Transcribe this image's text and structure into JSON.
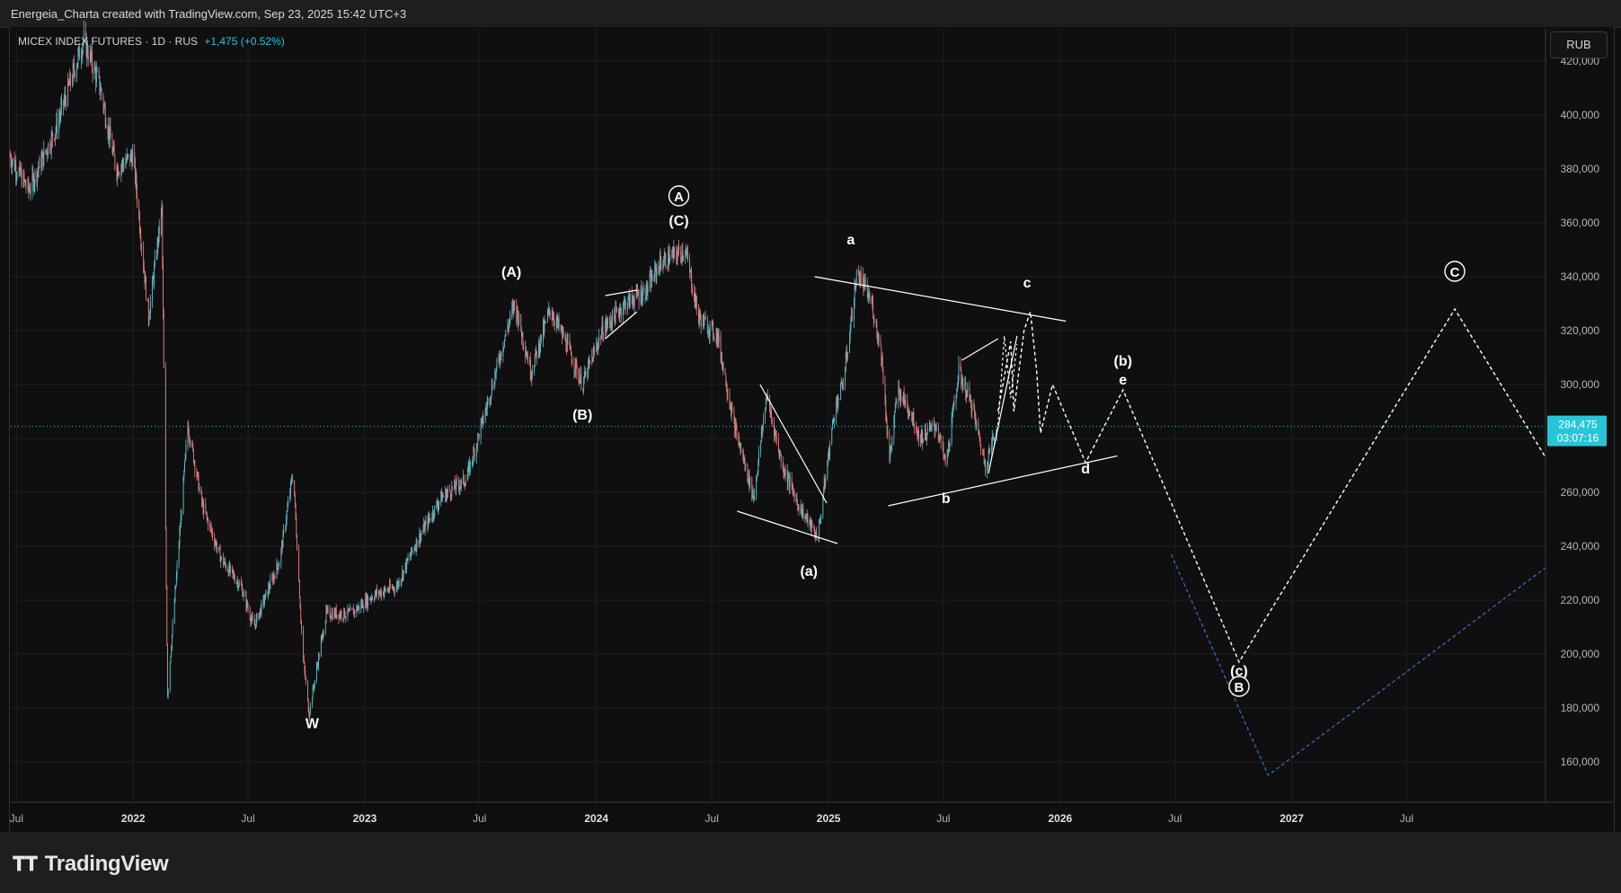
{
  "header": {
    "attribution": "Energeia_Charta created with TradingView.com, Sep 23, 2025 15:42 UTC+3"
  },
  "legend": {
    "symbol": "MICEX INDEX FUTURES · 1D · RUS",
    "change": "+1,475 (+0.52%)"
  },
  "currency_button": "RUB",
  "footer": {
    "logo_text": "TradingView",
    "logo_icon": "tradingview-logo-icon"
  },
  "price_label": {
    "value": "284,475",
    "countdown": "03:07:16"
  },
  "colors": {
    "background": "#0f0f0f",
    "up_candle": "#5fb7c4",
    "down_candle": "#e07a7a",
    "accent": "#26c6da",
    "wave_lines": "#ffffff",
    "projection_blue": "#3b6fd9"
  },
  "chart_data": {
    "type": "candlestick",
    "title": "",
    "xlabel": "",
    "ylabel": "",
    "x_ticks": [
      "Jul",
      "2022",
      "Jul",
      "2023",
      "Jul",
      "2024",
      "Jul",
      "2025",
      "Jul",
      "2026",
      "Jul",
      "2027",
      "Jul"
    ],
    "x_tick_dates": [
      "2021-07-01",
      "2022-01-01",
      "2022-07-01",
      "2023-01-01",
      "2023-07-01",
      "2024-01-01",
      "2024-07-01",
      "2025-01-01",
      "2025-07-01",
      "2026-01-01",
      "2026-07-01",
      "2027-01-01",
      "2027-07-01"
    ],
    "y_ticks": [
      160000,
      180000,
      200000,
      220000,
      240000,
      260000,
      280000,
      300000,
      320000,
      340000,
      360000,
      380000,
      400000,
      420000
    ],
    "y_tick_labels": [
      "160,000",
      "180,000",
      "200,000",
      "220,000",
      "240,000",
      "260,000",
      "280,000",
      "300,000",
      "320,000",
      "340,000",
      "360,000",
      "380,000",
      "400,000",
      "420,000"
    ],
    "ylim": [
      145000,
      432000
    ],
    "last_price": 284475,
    "price_anchors": [
      [
        "2021-06-20",
        385000
      ],
      [
        "2021-07-20",
        372000
      ],
      [
        "2021-09-01",
        395000
      ],
      [
        "2021-10-15",
        428000
      ],
      [
        "2021-11-10",
        410000
      ],
      [
        "2021-12-05",
        380000
      ],
      [
        "2022-01-01",
        385000
      ],
      [
        "2022-01-25",
        325000
      ],
      [
        "2022-02-15",
        365000
      ],
      [
        "2022-02-24",
        185000
      ],
      [
        "2022-03-28",
        285000
      ],
      [
        "2022-04-20",
        255000
      ],
      [
        "2022-05-20",
        235000
      ],
      [
        "2022-06-20",
        225000
      ],
      [
        "2022-07-10",
        210000
      ],
      [
        "2022-08-20",
        235000
      ],
      [
        "2022-09-10",
        268000
      ],
      [
        "2022-09-25",
        200000
      ],
      [
        "2022-10-05",
        178000
      ],
      [
        "2022-11-01",
        215000
      ],
      [
        "2022-12-10",
        215000
      ],
      [
        "2023-01-15",
        222000
      ],
      [
        "2023-02-20",
        225000
      ],
      [
        "2023-03-20",
        240000
      ],
      [
        "2023-05-01",
        258000
      ],
      [
        "2023-06-10",
        265000
      ],
      [
        "2023-07-10",
        290000
      ],
      [
        "2023-08-10",
        318000
      ],
      [
        "2023-08-25",
        330000
      ],
      [
        "2023-09-20",
        305000
      ],
      [
        "2023-10-20",
        328000
      ],
      [
        "2023-11-15",
        315000
      ],
      [
        "2023-12-10",
        300000
      ],
      [
        "2024-01-10",
        320000
      ],
      [
        "2024-02-15",
        330000
      ],
      [
        "2024-03-20",
        335000
      ],
      [
        "2024-04-10",
        345000
      ],
      [
        "2024-05-20",
        350000
      ],
      [
        "2024-06-10",
        325000
      ],
      [
        "2024-07-10",
        318000
      ],
      [
        "2024-08-05",
        285000
      ],
      [
        "2024-09-05",
        258000
      ],
      [
        "2024-09-25",
        296000
      ],
      [
        "2024-10-20",
        270000
      ],
      [
        "2024-11-15",
        255000
      ],
      [
        "2024-12-15",
        243000
      ],
      [
        "2024-12-25",
        262000
      ],
      [
        "2025-01-10",
        290000
      ],
      [
        "2025-01-25",
        302000
      ],
      [
        "2025-02-15",
        342000
      ],
      [
        "2025-03-10",
        330000
      ],
      [
        "2025-03-25",
        312000
      ],
      [
        "2025-04-07",
        272000
      ],
      [
        "2025-04-20",
        298000
      ],
      [
        "2025-05-10",
        290000
      ],
      [
        "2025-05-25",
        280000
      ],
      [
        "2025-06-20",
        285000
      ],
      [
        "2025-07-05",
        270000
      ],
      [
        "2025-07-25",
        305000
      ],
      [
        "2025-08-15",
        292000
      ],
      [
        "2025-09-05",
        270000
      ],
      [
        "2025-09-23",
        284475
      ]
    ],
    "wave_labels": [
      {
        "text": "W",
        "date": "2022-10-10",
        "value": 172500
      },
      {
        "text": "(A)",
        "date": "2023-08-20",
        "value": 340000
      },
      {
        "text": "(B)",
        "date": "2023-12-10",
        "value": 287000
      },
      {
        "text": "(C)",
        "date": "2024-05-10",
        "value": 359000
      },
      {
        "text": "A",
        "date": "2024-05-10",
        "value": 368000,
        "circled": true
      },
      {
        "text": "(a)",
        "date": "2024-12-01",
        "value": 229000
      },
      {
        "text": "a",
        "date": "2025-02-05",
        "value": 352000
      },
      {
        "text": "b",
        "date": "2025-07-05",
        "value": 256000
      },
      {
        "text": "c",
        "date": "2025-11-10",
        "value": 336000
      },
      {
        "text": "d",
        "date": "2026-02-10",
        "value": 267000
      },
      {
        "text": "e",
        "date": "2026-04-10",
        "value": 300000
      },
      {
        "text": "(b)",
        "date": "2026-04-10",
        "value": 307000
      },
      {
        "text": "(c)",
        "date": "2026-10-10",
        "value": 192000
      },
      {
        "text": "B",
        "date": "2026-10-10",
        "value": 186000,
        "circled": true
      },
      {
        "text": "C",
        "date": "2027-09-15",
        "value": 340000,
        "circled": true
      }
    ],
    "trend_lines": [
      {
        "from": [
          "2024-12-10",
          340000
        ],
        "to": [
          "2026-01-10",
          323500
        ]
      },
      {
        "from": [
          "2025-04-05",
          255000
        ],
        "to": [
          "2026-04-01",
          273500
        ]
      },
      {
        "from": [
          "2024-08-10",
          253000
        ],
        "to": [
          "2025-01-15",
          241000
        ]
      },
      {
        "from": [
          "2024-09-15",
          300000
        ],
        "to": [
          "2024-12-29",
          256000
        ]
      },
      {
        "from": [
          "2024-01-15",
          333000
        ],
        "to": [
          "2024-03-05",
          335000
        ]
      },
      {
        "from": [
          "2024-01-15",
          317000
        ],
        "to": [
          "2024-03-05",
          327000
        ]
      },
      {
        "from": [
          "2025-07-30",
          309000
        ],
        "to": [
          "2025-09-25",
          317000
        ]
      },
      {
        "from": [
          "2025-09-10",
          267000
        ],
        "to": [
          "2025-10-25",
          318000
        ]
      }
    ],
    "projection_path": [
      [
        "2025-09-25",
        290000
      ],
      [
        "2025-10-15",
        316000
      ],
      [
        "2025-10-20",
        290000
      ],
      [
        "2025-11-05",
        320000
      ],
      [
        "2025-11-15",
        327000
      ],
      [
        "2025-11-25",
        305000
      ],
      [
        "2025-12-01",
        282000
      ],
      [
        "2025-12-20",
        300000
      ],
      [
        "2026-02-10",
        271000
      ],
      [
        "2026-04-10",
        298000
      ],
      [
        "2026-10-10",
        197000
      ],
      [
        "2027-09-15",
        328000
      ],
      [
        "2028-02-05",
        273000
      ]
    ],
    "projection_inner": [
      [
        "2025-09-25",
        285000
      ],
      [
        "2025-10-05",
        318000
      ],
      [
        "2025-10-15",
        295000
      ],
      [
        "2025-10-25",
        315000
      ]
    ],
    "blue_projection": [
      [
        "2026-06-25",
        237000
      ],
      [
        "2026-11-25",
        155000
      ],
      [
        "2028-02-05",
        232000
      ]
    ]
  }
}
